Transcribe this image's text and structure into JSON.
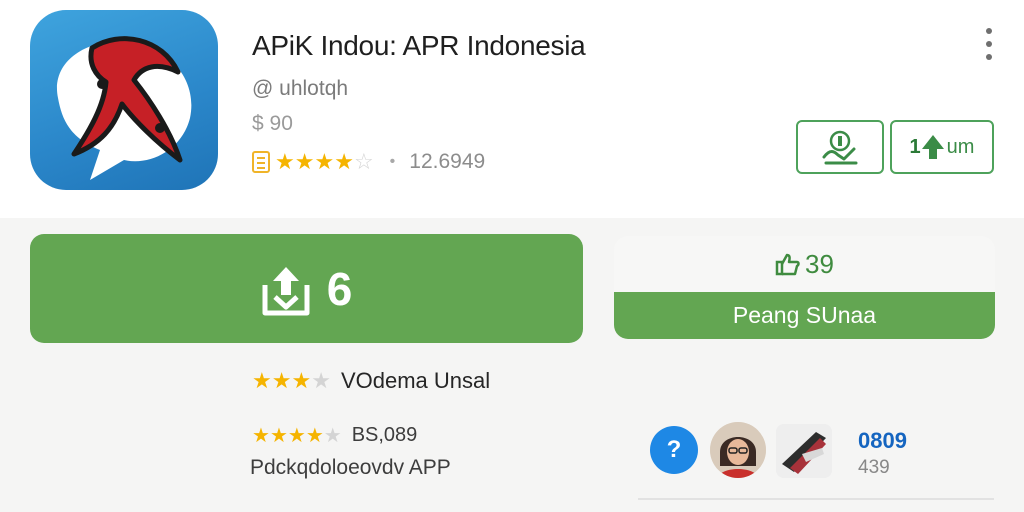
{
  "app": {
    "title": "APiK Indou: APR Indonesia",
    "developer": "@ uhlotqh",
    "price": "$ 90",
    "rating_count": "12.6949",
    "rating_stars": 3.5,
    "separator": "•"
  },
  "header_actions": {
    "more_icon": "more-vertical-icon",
    "wishlist_icon": "wishlist-icon",
    "share_number": "1",
    "share_label": "um"
  },
  "install": {
    "label": "6",
    "icon": "download-icon"
  },
  "side_card": {
    "count": "39",
    "button_label": "Peang SUnaa"
  },
  "reviews": [
    {
      "stars": 3,
      "text": "VOdema Unsal"
    },
    {
      "stars": 4,
      "text": "BS,089"
    }
  ],
  "package_label": "Pdckqdoloeovdv APP",
  "stats": {
    "value_primary": "0809",
    "value_secondary": "439"
  },
  "colors": {
    "accent_green": "#63a652",
    "star_gold": "#f5b400",
    "icon_blue": "#2a86c9",
    "help_blue": "#1e88e5"
  }
}
